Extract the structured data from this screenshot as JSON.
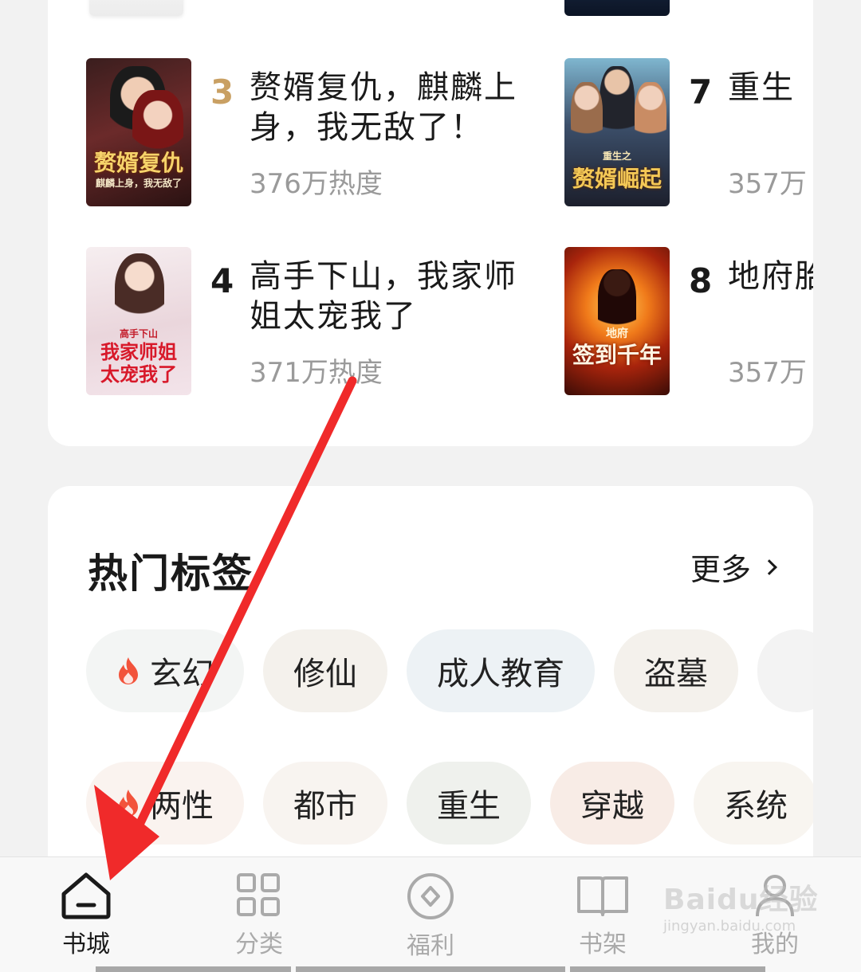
{
  "rank_list": {
    "items": [
      {
        "rank": "3",
        "title": "赘婿复仇，麒麟上身，我无敌了！",
        "heat": "376万热度",
        "cover_text": "赘婿复仇",
        "cover_sub": "麒麟上身，我无敌了"
      },
      {
        "rank": "4",
        "title": "高手下山，我家师姐太宠我了",
        "heat": "371万热度",
        "cover_text": "我家师姐太宠我了",
        "cover_sub": "高手下山"
      },
      {
        "rank": "7",
        "title": "重生",
        "heat": "357万",
        "cover_text": "赘婿崛起",
        "cover_sub": "重生之"
      },
      {
        "rank": "8",
        "title": "地府胎气",
        "heat": "357万",
        "cover_text": "签到千年",
        "cover_sub": "地府"
      }
    ]
  },
  "tags": {
    "title": "热门标签",
    "more_label": "更多",
    "row1": [
      "玄幻",
      "修仙",
      "成人教育",
      "盗墓",
      ""
    ],
    "row2": [
      "两性",
      "都市",
      "重生",
      "穿越",
      "系统"
    ],
    "colors": [
      "#f3f5f4",
      "#f4f1ec",
      "#edf2f5",
      "#f4f1ec",
      "#f3f3f3"
    ]
  },
  "nav": {
    "items": [
      "书城",
      "分类",
      "福利",
      "书架",
      "我的"
    ],
    "active": "书城"
  },
  "watermark": {
    "main": "Baidu经验",
    "sub": "jingyan.baidu.com"
  },
  "colors": {
    "accent_rank": "#c9a063",
    "arrow": "#f02a2a",
    "flame": "#f2533b"
  }
}
